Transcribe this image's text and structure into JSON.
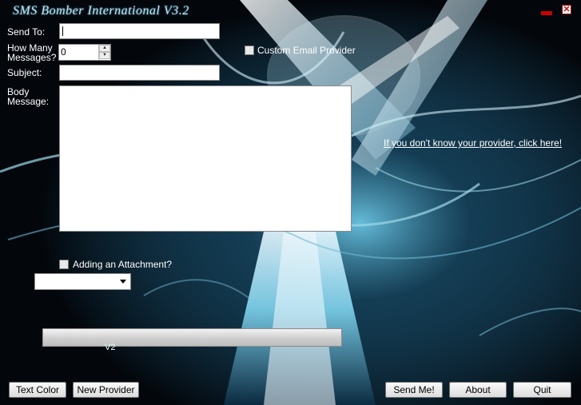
{
  "window": {
    "title": "SMS Bomber International V3.2"
  },
  "form": {
    "send_to_label": "Send To:",
    "send_to_value": "",
    "how_many_label_line1": "How Many",
    "how_many_label_line2": "Messages?",
    "how_many_value": "0",
    "custom_email_label": "Custom Email Provider",
    "subject_label": "Subject:",
    "subject_value": "",
    "body_label_line1": "Body",
    "body_label_line2": "Message:",
    "body_value": "",
    "provider_link": "If you don't know your provider, click here!",
    "attachment_label": "Adding an Attachment?",
    "provider_select_value": "",
    "version_text": "V2",
    "progress": 0.0
  },
  "buttons": {
    "text_color": "Text Color",
    "new_provider": "New Provider",
    "send_me": "Send Me!",
    "about": "About",
    "quit": "Quit"
  },
  "colors": {
    "accent_red": "#cc0000",
    "background_dark": "#050a10",
    "glass_cyan": "#7fd3ee"
  },
  "icons": {
    "minimize": "minimize-icon",
    "close": "close-icon",
    "spin_up": "chevron-up-icon",
    "spin_down": "chevron-down-icon",
    "dropdown": "chevron-down-icon"
  }
}
